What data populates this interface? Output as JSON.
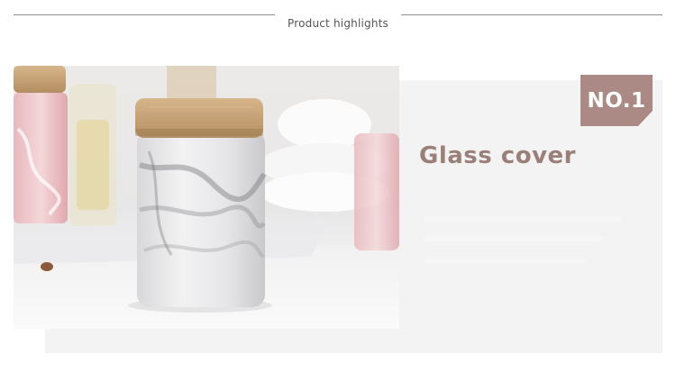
{
  "header": {
    "title": "Product highlights"
  },
  "feature": {
    "badge_label": "NO.1",
    "title": "Glass cover"
  },
  "colors": {
    "badge": "#ab8a86",
    "title": "#9b807a",
    "rule": "#8f8f8f",
    "panel": "#f3f3f3"
  },
  "photo": {
    "subject": "marble-ceramic-jar-with-bamboo-lid"
  }
}
